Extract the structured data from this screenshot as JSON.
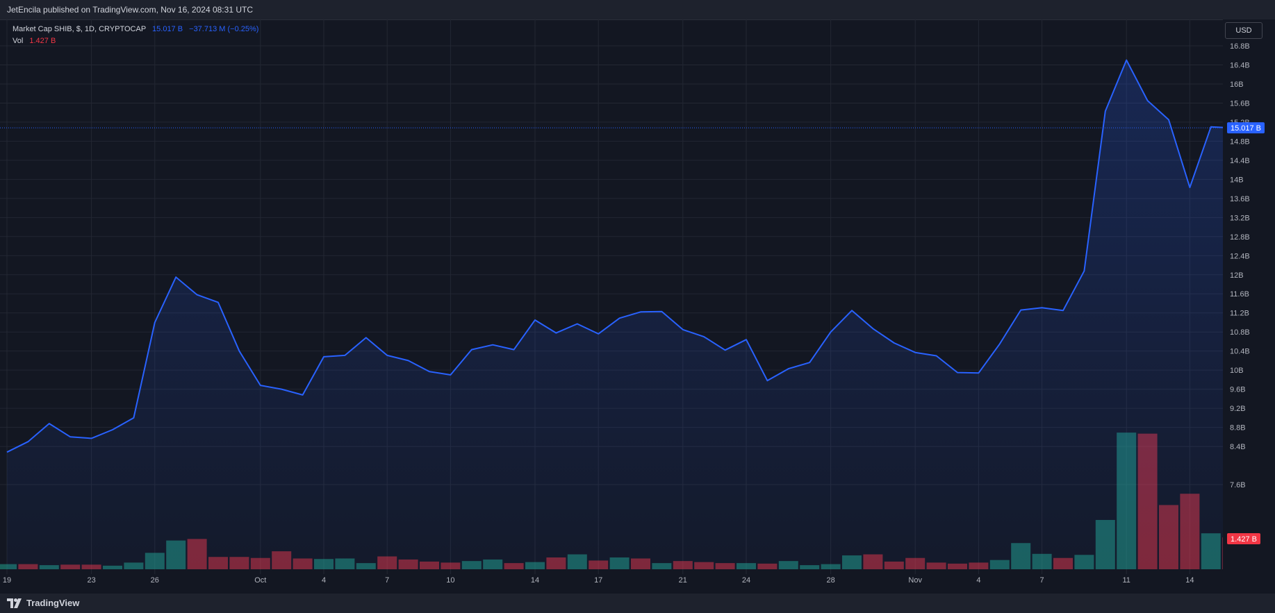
{
  "header": {
    "text": "JetEncila published on TradingView.com, Nov 16, 2024 08:31 UTC"
  },
  "legend": {
    "symbol": "Market Cap SHIB, $, 1D, CRYPTOCAP",
    "price": "15.017 B",
    "change": "−37.713 M (−0.25%)",
    "vol_label": "Vol",
    "vol_value": "1.427 B"
  },
  "currency": "USD",
  "price_badge": "15.017 B",
  "vol_badge": "1.427 B",
  "footer": {
    "brand": "TradingView"
  },
  "colors": {
    "line": "#2962ff",
    "up_volume": "#22ab94",
    "down_volume": "#f23645",
    "background": "#131722",
    "grid": "#232733"
  },
  "chart_data": {
    "type": "area",
    "title": "Market Cap SHIB, $, 1D, CRYPTOCAP",
    "y_unit": "USD",
    "ylim": [
      7.4,
      17.0
    ],
    "y_ticks": [
      "16.8B",
      "16.4B",
      "16B",
      "15.6B",
      "15.2B",
      "14.8B",
      "14.4B",
      "14B",
      "13.6B",
      "13.2B",
      "12.8B",
      "12.4B",
      "12B",
      "11.6B",
      "11.2B",
      "10.8B",
      "10.4B",
      "10B",
      "9.6B",
      "9.2B",
      "8.8B",
      "8.4B",
      "7.6B"
    ],
    "y_tick_values": [
      16.8,
      16.4,
      16.0,
      15.6,
      15.2,
      14.8,
      14.4,
      14.0,
      13.6,
      13.2,
      12.8,
      12.4,
      12.0,
      11.6,
      11.2,
      10.8,
      10.4,
      10.0,
      9.6,
      9.2,
      8.8,
      8.4,
      7.6
    ],
    "x_ticks": [
      {
        "label": "19",
        "index": 0
      },
      {
        "label": "23",
        "index": 4
      },
      {
        "label": "26",
        "index": 7
      },
      {
        "label": "Oct",
        "index": 12
      },
      {
        "label": "4",
        "index": 15
      },
      {
        "label": "7",
        "index": 18
      },
      {
        "label": "10",
        "index": 21
      },
      {
        "label": "14",
        "index": 25
      },
      {
        "label": "17",
        "index": 28
      },
      {
        "label": "21",
        "index": 32
      },
      {
        "label": "24",
        "index": 35
      },
      {
        "label": "28",
        "index": 39
      },
      {
        "label": "Nov",
        "index": 43
      },
      {
        "label": "4",
        "index": 46
      },
      {
        "label": "7",
        "index": 49
      },
      {
        "label": "11",
        "index": 53
      },
      {
        "label": "14",
        "index": 56
      }
    ],
    "series": [
      {
        "name": "Market Cap SHIB",
        "values": [
          8.28,
          8.5,
          8.88,
          8.6,
          8.57,
          8.75,
          9.0,
          11.0,
          11.95,
          11.58,
          11.42,
          10.4,
          9.68,
          9.6,
          9.48,
          10.28,
          10.31,
          10.68,
          10.31,
          10.2,
          9.97,
          9.9,
          10.43,
          10.53,
          10.43,
          11.05,
          10.78,
          10.97,
          10.76,
          11.09,
          11.22,
          11.23,
          10.85,
          10.7,
          10.42,
          10.64,
          9.78,
          10.03,
          10.16,
          10.8,
          11.25,
          10.87,
          10.57,
          10.37,
          10.3,
          9.95,
          9.94,
          10.55,
          11.26,
          11.31,
          11.25,
          12.08,
          15.43,
          16.5,
          15.65,
          15.25,
          13.83,
          15.1,
          15.08
        ]
      }
    ],
    "volume": {
      "name": "Vol",
      "values": [
        0.1,
        0.1,
        0.08,
        0.09,
        0.09,
        0.07,
        0.13,
        0.32,
        0.56,
        0.59,
        0.24,
        0.24,
        0.22,
        0.35,
        0.21,
        0.2,
        0.21,
        0.12,
        0.25,
        0.19,
        0.15,
        0.13,
        0.16,
        0.19,
        0.12,
        0.14,
        0.23,
        0.29,
        0.17,
        0.23,
        0.21,
        0.12,
        0.16,
        0.14,
        0.12,
        0.12,
        0.11,
        0.16,
        0.08,
        0.1,
        0.27,
        0.29,
        0.15,
        0.22,
        0.13,
        0.11,
        0.13,
        0.18,
        0.51,
        0.3,
        0.22,
        0.28,
        0.96,
        2.66,
        2.64,
        1.25,
        1.47,
        0.7,
        0.62
      ],
      "up": [
        1,
        0,
        1,
        0,
        0,
        1,
        1,
        1,
        1,
        0,
        0,
        0,
        0,
        0,
        0,
        1,
        1,
        1,
        0,
        0,
        0,
        0,
        1,
        1,
        0,
        1,
        0,
        1,
        0,
        1,
        0,
        1,
        0,
        0,
        0,
        1,
        0,
        1,
        1,
        1,
        1,
        0,
        0,
        0,
        0,
        0,
        0,
        1,
        1,
        1,
        0,
        1,
        1,
        1,
        0,
        0,
        0,
        1,
        0
      ]
    }
  }
}
